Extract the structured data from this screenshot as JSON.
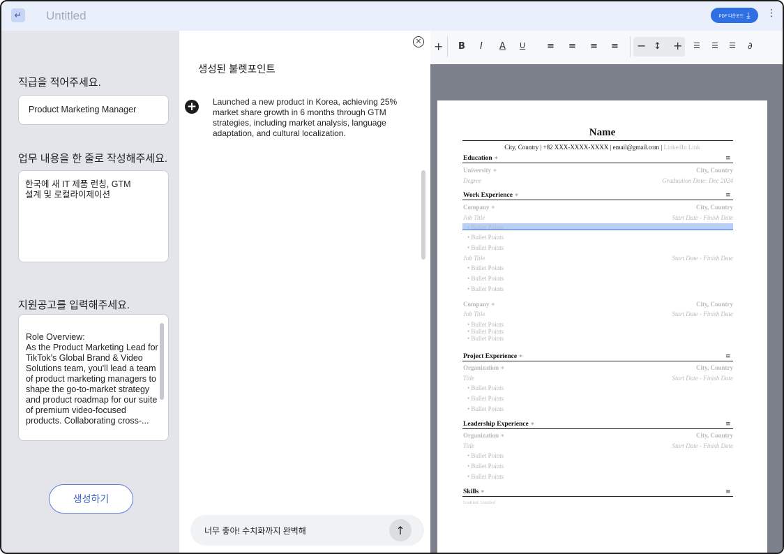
{
  "header": {
    "back_icon": "return-arrow-icon",
    "title": "Untitled",
    "pdf_button": "PDF 다운로드",
    "more_icon": "kebab-menu-icon"
  },
  "left_panel": {
    "position_label": "직급을 적어주세요.",
    "position_value": "Product Marketing Manager",
    "duty_label": "업무 내용을 한 줄로 작성해주세요.",
    "duty_value": "한국에 새 IT 제품 런칭, GTM\n설계 및 로컬라이제이션",
    "posting_label": "지원공고를 입력해주세요.",
    "posting_value": "Role Overview:\nAs the Product Marketing Lead for TikTok's Global Brand & Video Solutions team, you'll lead a team of product marketing managers to shape the go-to-market strategy and product roadmap for our suite of premium video-focused products. Collaborating cross-...",
    "generate_button": "생성하기"
  },
  "middle_panel": {
    "title": "생성된 불렛포인트",
    "bullets": [
      "Launched a new product in Korea, achieving 25% market share growth in 6 months through GTM strategies, including market analysis, language adaptation, and cultural localization."
    ],
    "chat_input": "너무 좋아! 수치화까지 완벽해"
  },
  "toolbar": {
    "items": [
      "+",
      "B",
      "I",
      "A",
      "U",
      "align-left",
      "align-center",
      "align-right",
      "justify",
      "−",
      "line-height",
      "+",
      "list",
      "indent",
      "outdent",
      "link"
    ]
  },
  "resume": {
    "name": "Name",
    "contact": "City, Country | +82 XXX-XXXX-XXXX | email@gmail.com | ",
    "contact_placeholder": "LinkedIn Link",
    "education": {
      "heading": "Education",
      "university": "University",
      "location": "City, Country",
      "degree": "Degree",
      "grad_date": "Graduation Date: Dec 2024"
    },
    "work": {
      "heading": "Work Experience",
      "company": "Company",
      "location": "City, Country",
      "job_title": "Job Title",
      "dates": "Start Date - Finish Date",
      "bullet": "Bullet Points"
    },
    "project": {
      "heading": "Project Experience",
      "organization": "Organization",
      "location": "City, Country",
      "title": "Title",
      "dates": "Start Date - Finish Date",
      "bullet": "Bullet Points"
    },
    "leadership": {
      "heading": "Leadership Experience",
      "organization": "Organization",
      "location": "City, Country",
      "title": "Title",
      "dates": "Start Date - Finish Date",
      "bullet": "Bullet Points"
    },
    "skills": {
      "heading": "Skills",
      "line": "Untitled: Untitled"
    }
  }
}
